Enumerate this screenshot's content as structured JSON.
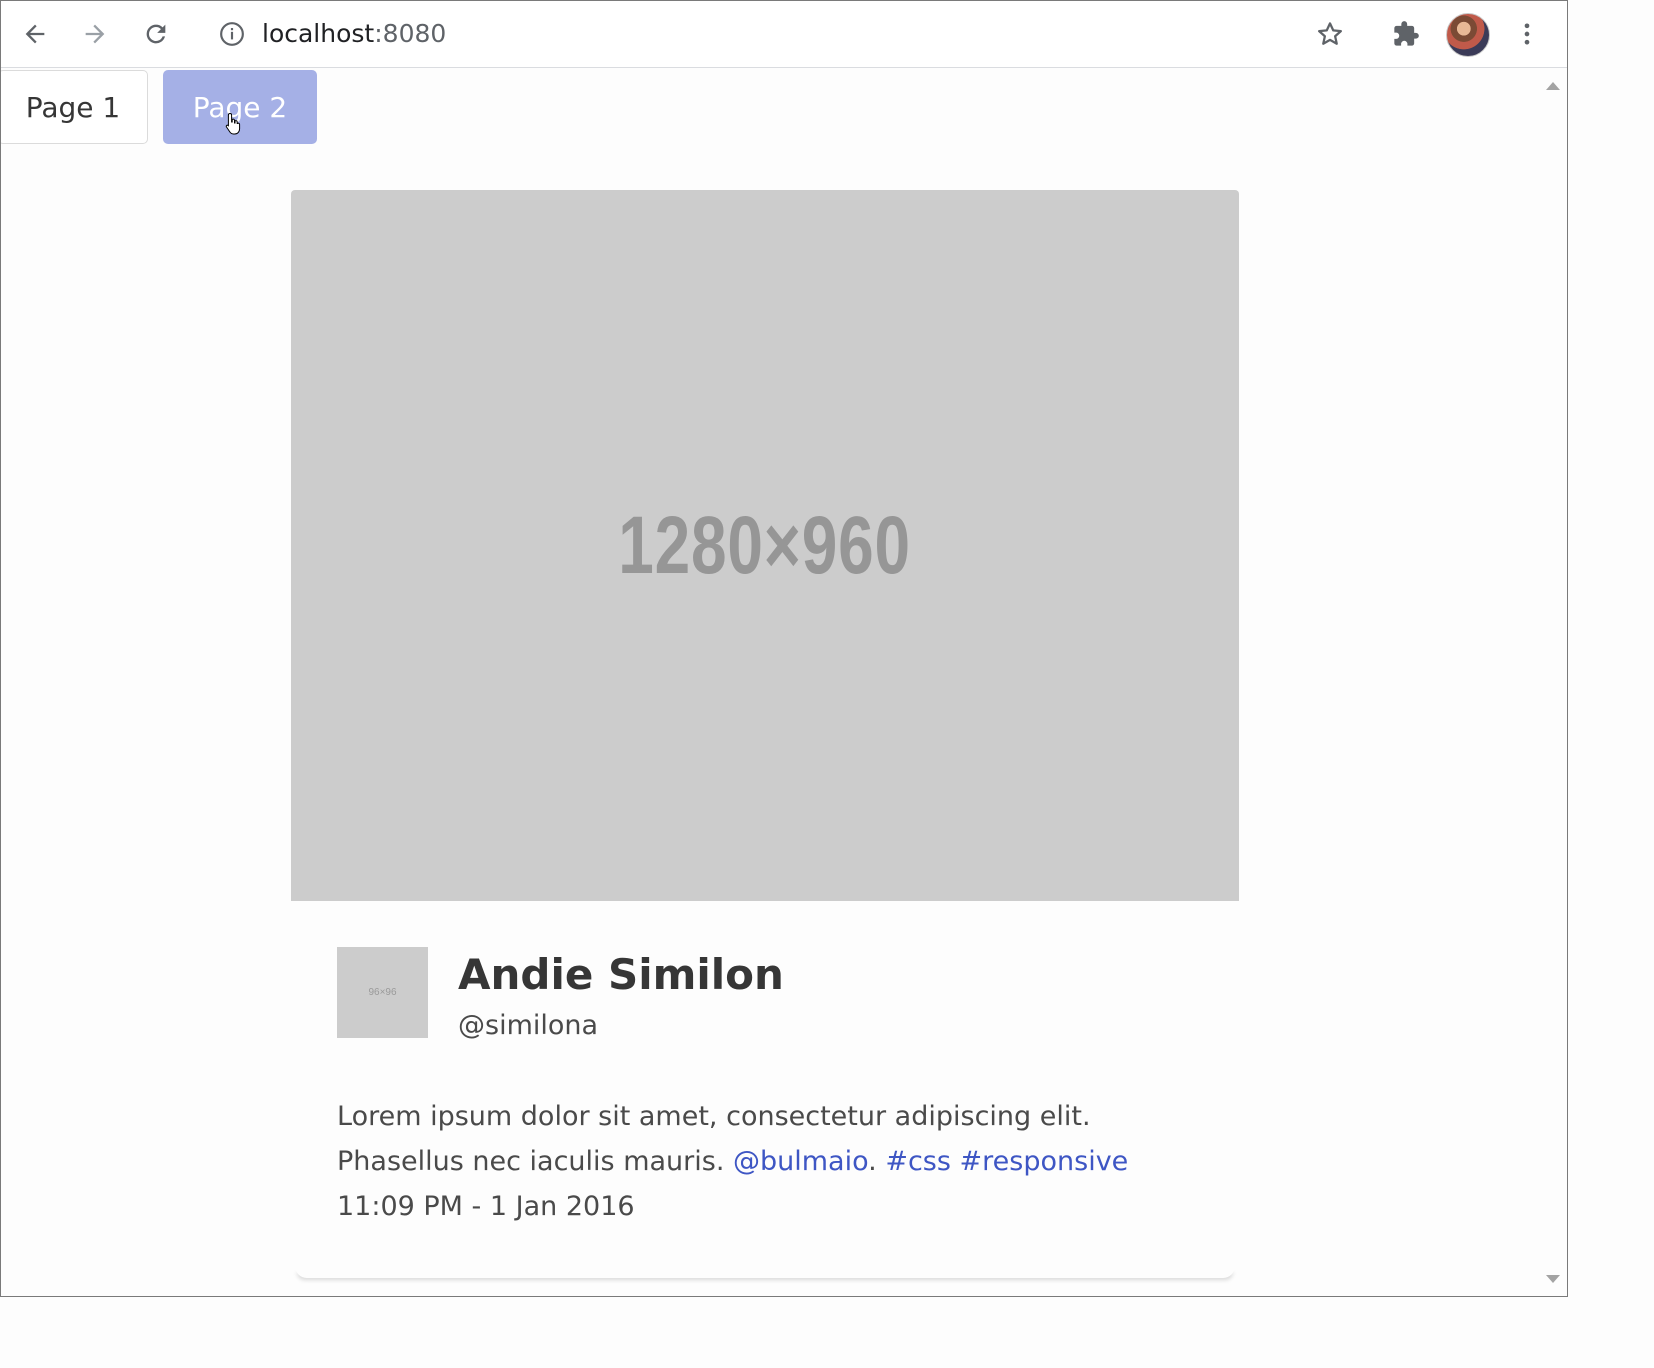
{
  "browser": {
    "url_host": "localhost",
    "url_port": ":8080",
    "icons": [
      "back-arrow-icon",
      "forward-arrow-icon",
      "reload-icon",
      "info-icon",
      "star-icon",
      "puzzle-icon",
      "more-vert-icon"
    ]
  },
  "nav": {
    "page1_label": "Page 1",
    "page2_label": "Page 2",
    "active_page": "Page 2"
  },
  "card": {
    "image_label": "1280×960",
    "avatar_label": "96×96",
    "name": "Andie Similon",
    "handle": "@similona",
    "text": "Lorem ipsum dolor sit amet, consectetur adipiscing elit. Phasellus nec iaculis mauris.",
    "mention": "@bulmaio",
    "period": ".",
    "tag1": "#css",
    "tag2": "#responsive",
    "timestamp": "11:09 PM - 1 Jan 2016"
  },
  "colors": {
    "accent_button": "#a5b0e6",
    "link": "#3e56c4",
    "placeholder": "#cccccc"
  }
}
